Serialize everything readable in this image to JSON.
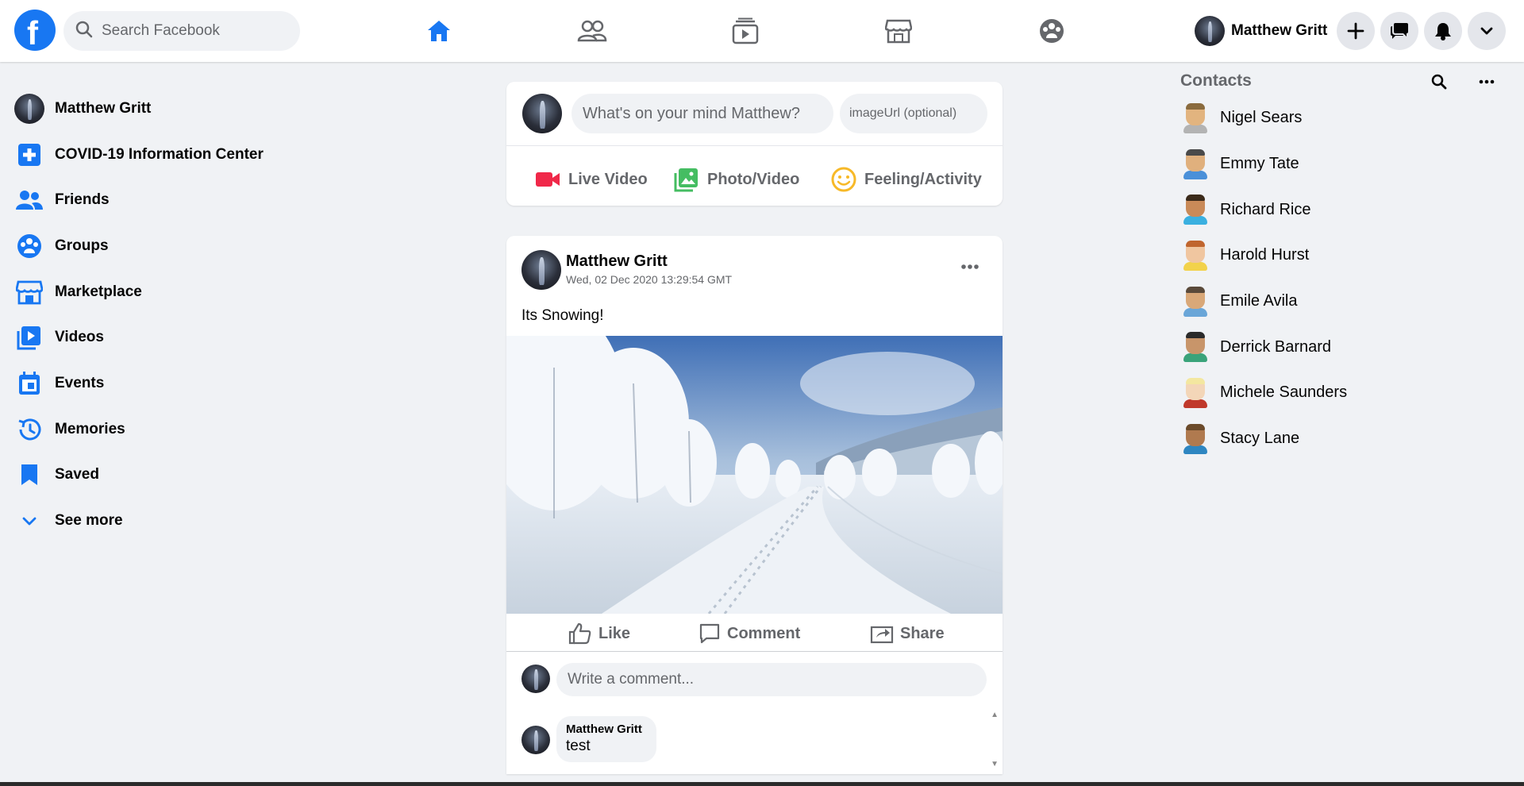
{
  "header": {
    "search_placeholder": "Search Facebook",
    "user_name": "Matthew Gritt",
    "nav": [
      "home",
      "friends",
      "watch",
      "marketplace",
      "groups"
    ],
    "buttons": [
      "create",
      "messenger",
      "notifications",
      "account-menu"
    ],
    "accent_color": "#1877f2"
  },
  "sidebar": {
    "items": [
      {
        "label": "Matthew Gritt",
        "icon": "avatar"
      },
      {
        "label": "COVID-19 Information Center",
        "icon": "covid-info-icon"
      },
      {
        "label": "Friends",
        "icon": "friends-icon"
      },
      {
        "label": "Groups",
        "icon": "groups-icon"
      },
      {
        "label": "Marketplace",
        "icon": "marketplace-icon"
      },
      {
        "label": "Videos",
        "icon": "videos-icon"
      },
      {
        "label": "Events",
        "icon": "events-icon"
      },
      {
        "label": "Memories",
        "icon": "memories-icon"
      },
      {
        "label": "Saved",
        "icon": "saved-icon"
      },
      {
        "label": "See more",
        "icon": "chevron-down-icon"
      }
    ]
  },
  "composer": {
    "placeholder": "What's on your mind Matthew?",
    "image_placeholder": "imageUrl (optional)",
    "live_video": "Live Video",
    "photo_video": "Photo/Video",
    "feeling": "Feeling/Activity"
  },
  "post": {
    "author": "Matthew Gritt",
    "timestamp": "Wed, 02 Dec 2020 13:29:54 GMT",
    "text": "Its Snowing!",
    "like": "Like",
    "comment": "Comment",
    "share": "Share",
    "comment_placeholder": "Write a comment...",
    "comments": [
      {
        "author": "Matthew Gritt",
        "text": "test"
      }
    ]
  },
  "contacts": {
    "title": "Contacts",
    "people": [
      {
        "name": "Nigel Sears"
      },
      {
        "name": "Emmy Tate"
      },
      {
        "name": "Richard Rice"
      },
      {
        "name": "Harold Hurst"
      },
      {
        "name": "Emile Avila"
      },
      {
        "name": "Derrick Barnard"
      },
      {
        "name": "Michele Saunders"
      },
      {
        "name": "Stacy Lane"
      }
    ]
  }
}
